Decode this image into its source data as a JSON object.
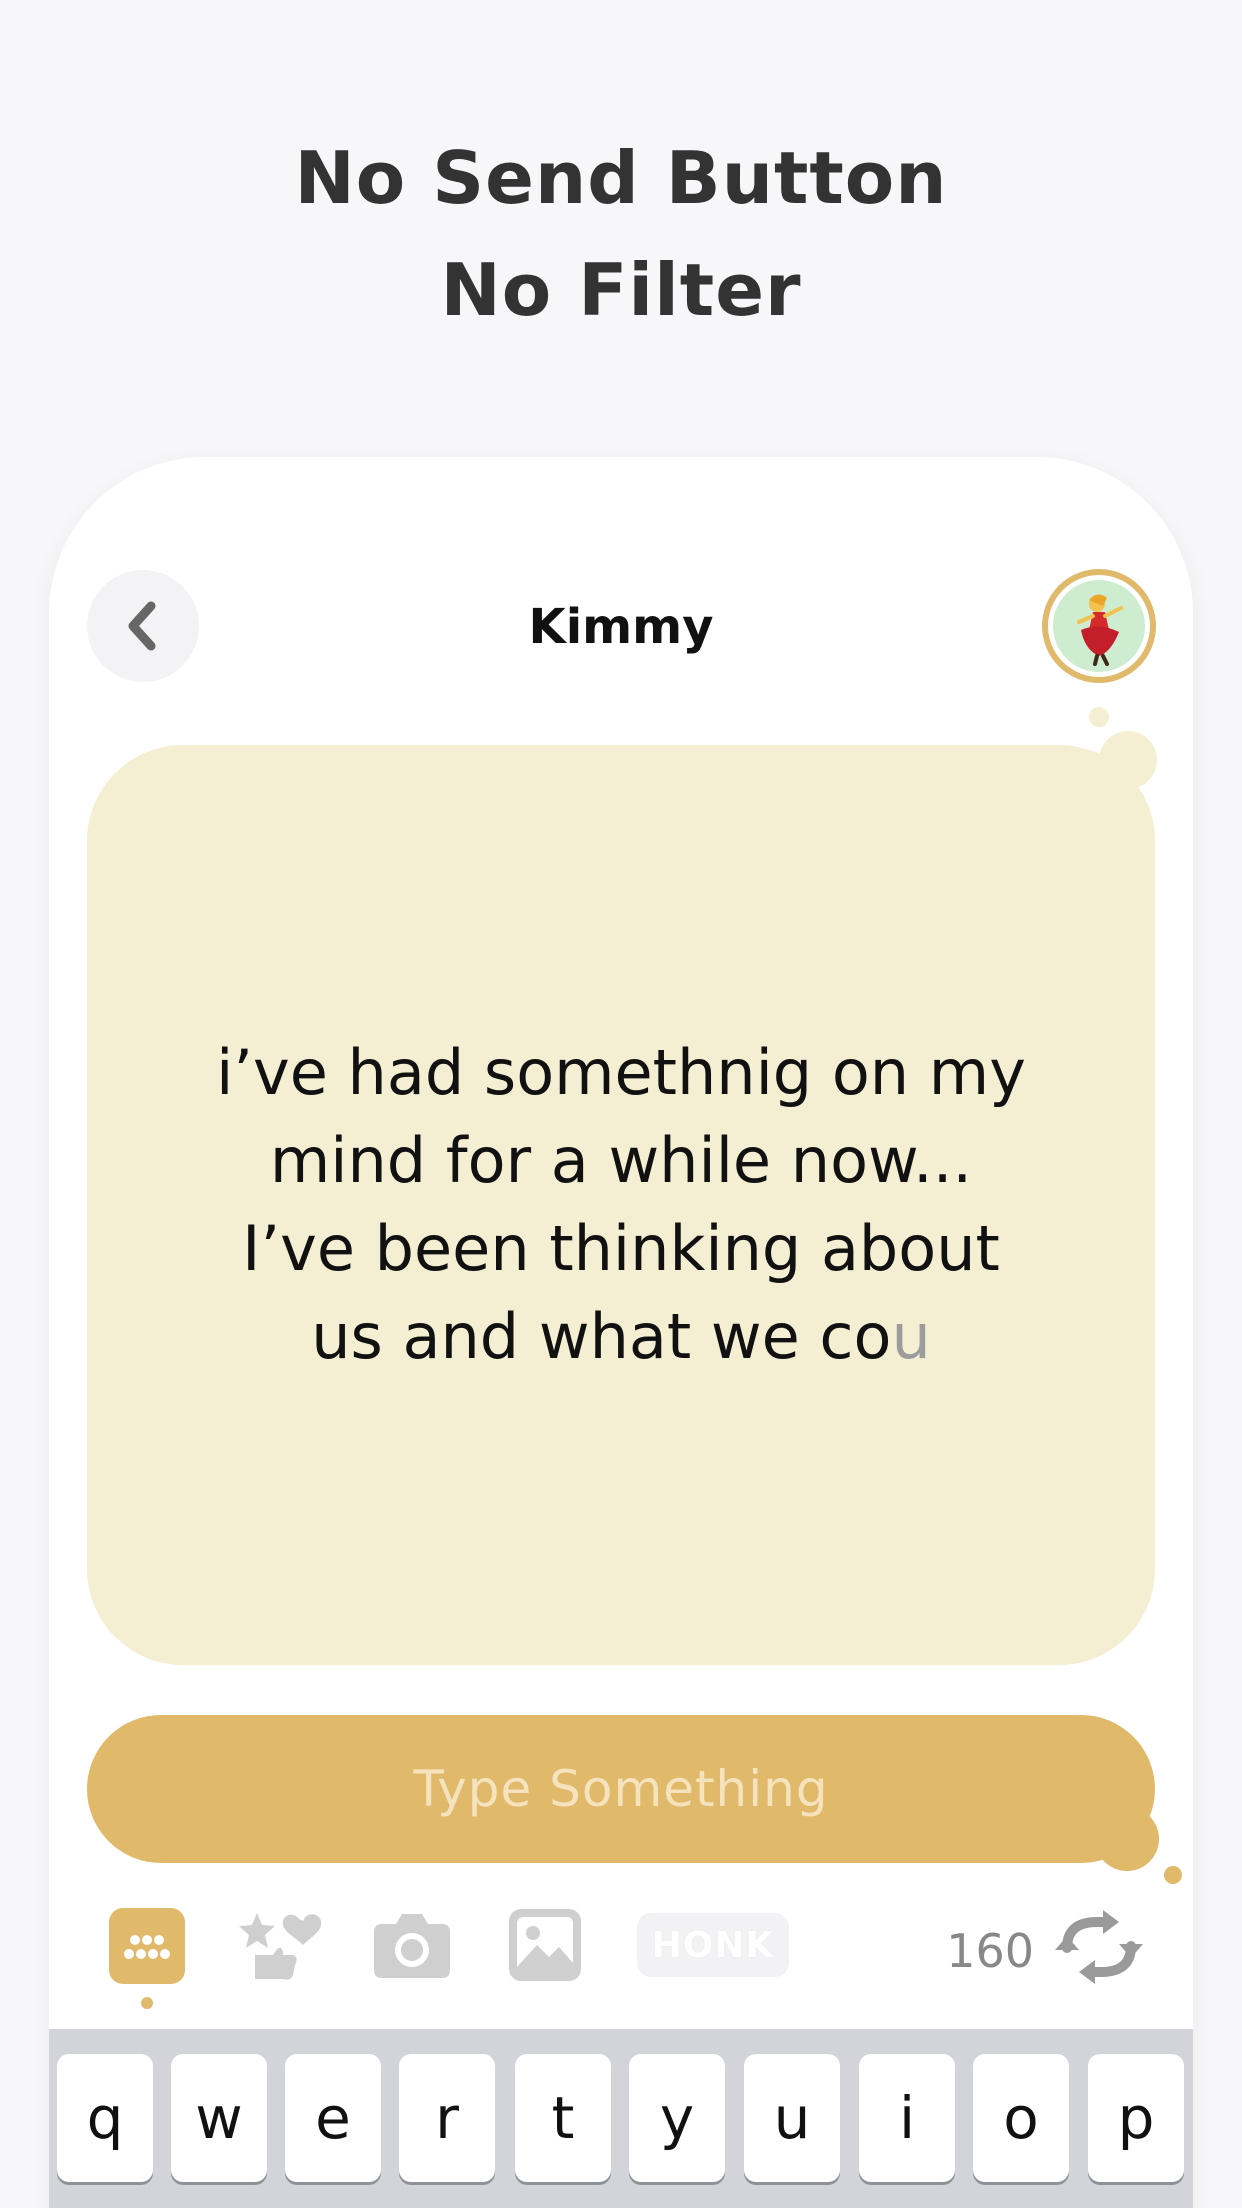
{
  "headline": {
    "line1": "No Send Button",
    "line2": "No Filter"
  },
  "header": {
    "title": "Kimmy"
  },
  "message": {
    "lines": [
      "i’ve had somethnig on my",
      "mind for a while now...",
      "I’ve been thinking about"
    ],
    "last_line_main": "us and what we co",
    "last_line_fading": "u"
  },
  "input": {
    "placeholder": "Type Something"
  },
  "toolbar": {
    "honk_label": "HONK",
    "char_count": "160",
    "icons": [
      "keyboard-icon",
      "sticker-icon",
      "camera-icon",
      "image-icon",
      "honk-icon",
      "refresh-icon"
    ]
  },
  "keyboard": {
    "row1": [
      "q",
      "w",
      "e",
      "r",
      "t",
      "y",
      "u",
      "i",
      "o",
      "p"
    ]
  },
  "colors": {
    "accent": "#e1b96b",
    "bubble": "#f4eed3",
    "background": "#f7f7f9",
    "text": "#111111",
    "icon_gray": "#c8c8c8"
  }
}
